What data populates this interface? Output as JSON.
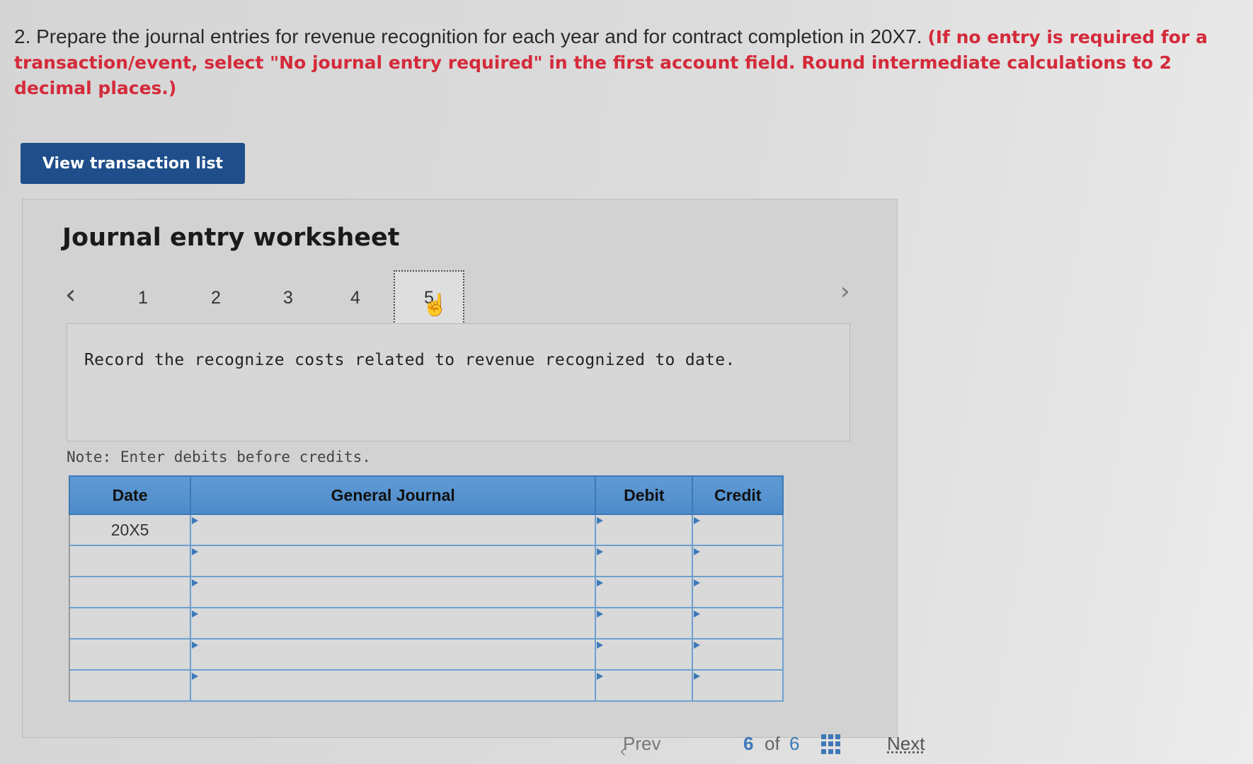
{
  "question": {
    "text": "2. Prepare the journal entries for revenue recognition for each year and for contract completion in 20X7.",
    "instruction": "(If no entry is required for a transaction/event, select \"No journal entry required\" in the first account field. Round intermediate calculations to 2 decimal places.)"
  },
  "view_button_label": "View transaction list",
  "worksheet": {
    "title": "Journal entry worksheet",
    "tabs": [
      "1",
      "2",
      "3",
      "4",
      "5"
    ],
    "active_tab": "5",
    "instruction": "Record the recognize costs related to revenue recognized to date.",
    "note": "Note: Enter debits before credits."
  },
  "journal": {
    "headers": {
      "date": "Date",
      "general_journal": "General Journal",
      "debit": "Debit",
      "credit": "Credit"
    },
    "rows": [
      {
        "date": "20X5",
        "account": "",
        "debit": "",
        "credit": ""
      },
      {
        "date": "",
        "account": "",
        "debit": "",
        "credit": ""
      },
      {
        "date": "",
        "account": "",
        "debit": "",
        "credit": ""
      },
      {
        "date": "",
        "account": "",
        "debit": "",
        "credit": ""
      },
      {
        "date": "",
        "account": "",
        "debit": "",
        "credit": ""
      },
      {
        "date": "",
        "account": "",
        "debit": "",
        "credit": ""
      }
    ]
  },
  "pagination": {
    "prev_label": "Prev",
    "current": "6",
    "of_label": "of",
    "total": "6",
    "next_label": "Next"
  },
  "colors": {
    "button_bg": "#1f4e8a",
    "instruction_red": "#d42a3a",
    "table_header": "#5f9ad4",
    "link_blue": "#3d79b8"
  }
}
